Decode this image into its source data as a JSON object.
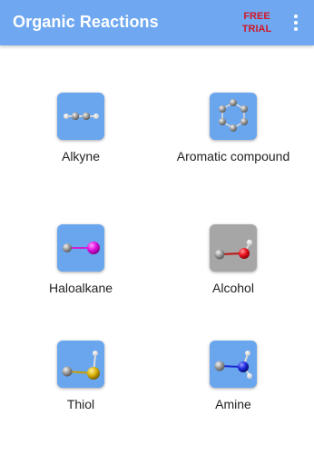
{
  "app": {
    "title": "Organic Reactions",
    "trial_line1": "FREE",
    "trial_line2": "TRIAL"
  },
  "colors": {
    "appbar": "#6fa8f0",
    "tile_blue": "#6aa6ee",
    "tile_gray": "#a6a6a6",
    "trial_text": "#d0182a"
  },
  "items": [
    {
      "label": "Alkyne",
      "icon": "alkyne-molecule-icon"
    },
    {
      "label": "Aromatic compound",
      "icon": "benzene-ring-icon"
    },
    {
      "label": "Haloalkane",
      "icon": "haloalkane-molecule-icon"
    },
    {
      "label": "Alcohol",
      "icon": "alcohol-molecule-icon"
    },
    {
      "label": "Thiol",
      "icon": "thiol-molecule-icon"
    },
    {
      "label": "Amine",
      "icon": "amine-molecule-icon"
    }
  ]
}
